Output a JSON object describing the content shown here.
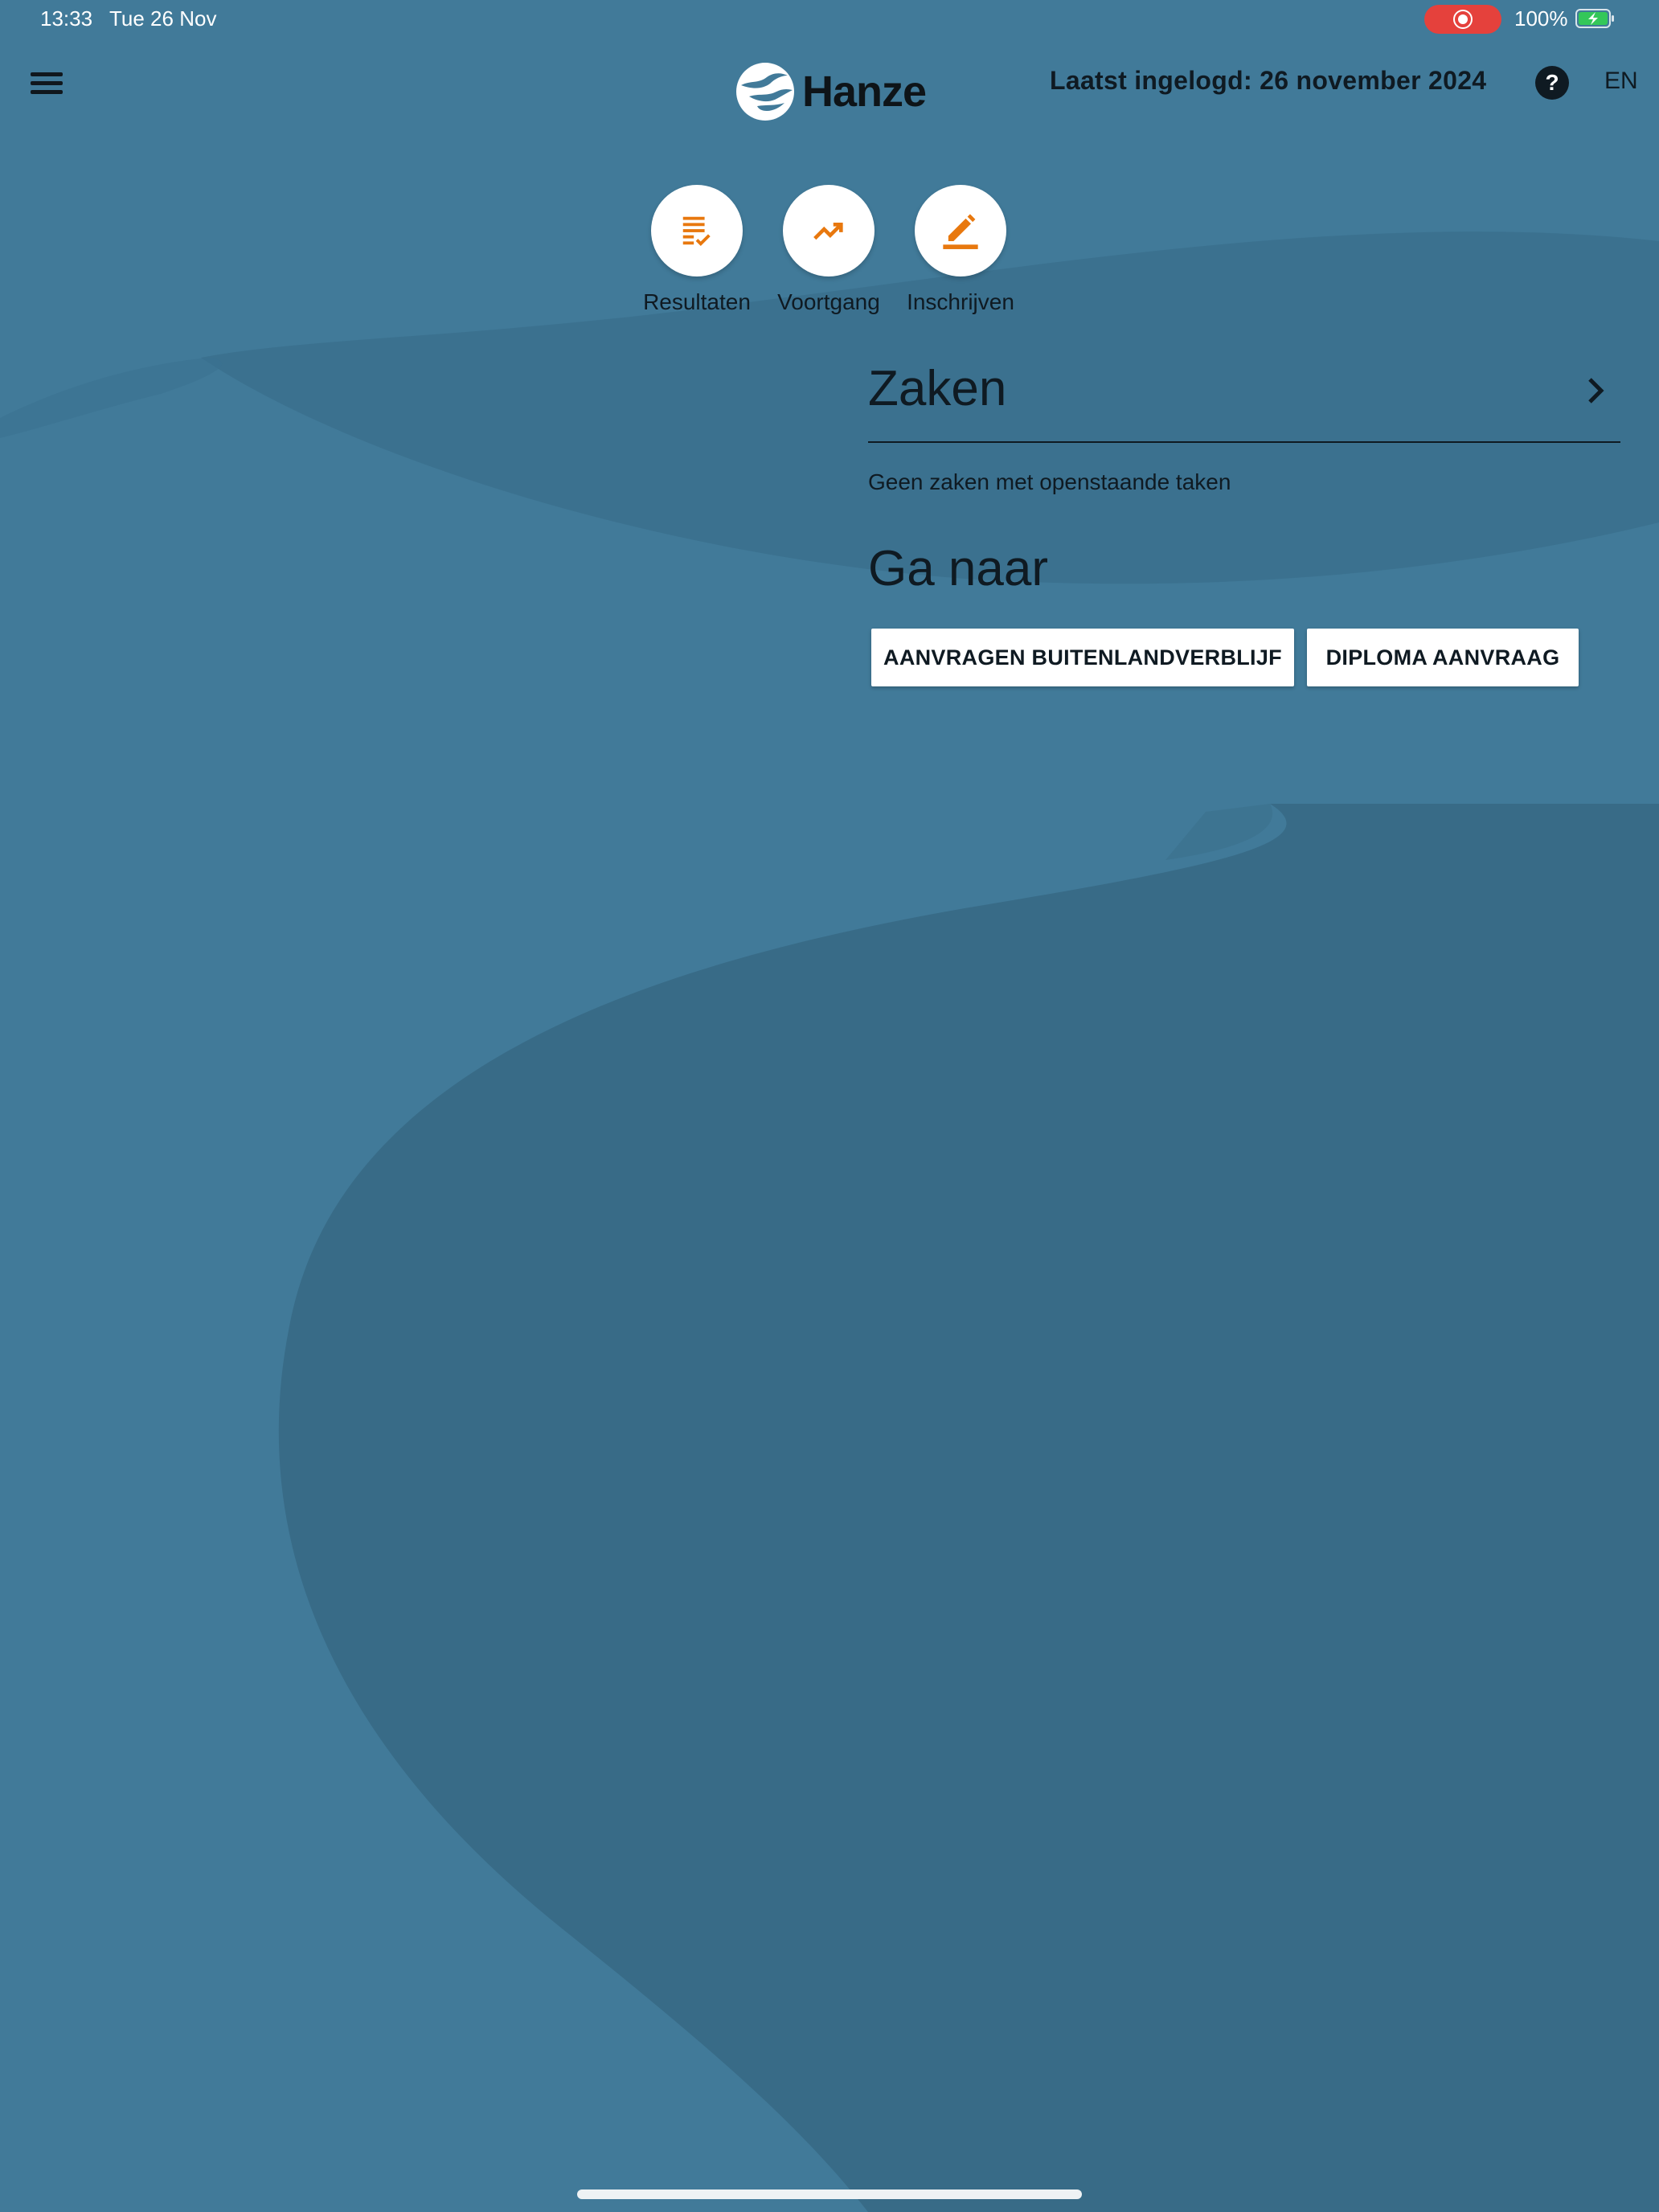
{
  "status_bar": {
    "time": "13:33",
    "date": "Tue 26 Nov",
    "battery_percent": "100%",
    "recording_color": "#e5413c",
    "battery_color": "#34c759"
  },
  "header": {
    "logo_text": "Hanze",
    "last_login": "Laatst ingelogd: 26 november 2024",
    "help_symbol": "?",
    "language": "EN"
  },
  "quick_actions": [
    {
      "label": "Resultaten",
      "icon": "list-check-icon"
    },
    {
      "label": "Voortgang",
      "icon": "trending-up-icon"
    },
    {
      "label": "Inschrijven",
      "icon": "pencil-icon"
    }
  ],
  "zaken": {
    "title": "Zaken",
    "empty_message": "Geen zaken met openstaande taken"
  },
  "ga_naar": {
    "title": "Ga naar",
    "buttons": [
      "AANVRAGEN BUITENLANDVERBLIJF",
      "DIPLOMA AANVRAAG"
    ]
  },
  "theme": {
    "accent": "#e8780e",
    "background": "#417a99",
    "text": "#0f1a22"
  }
}
